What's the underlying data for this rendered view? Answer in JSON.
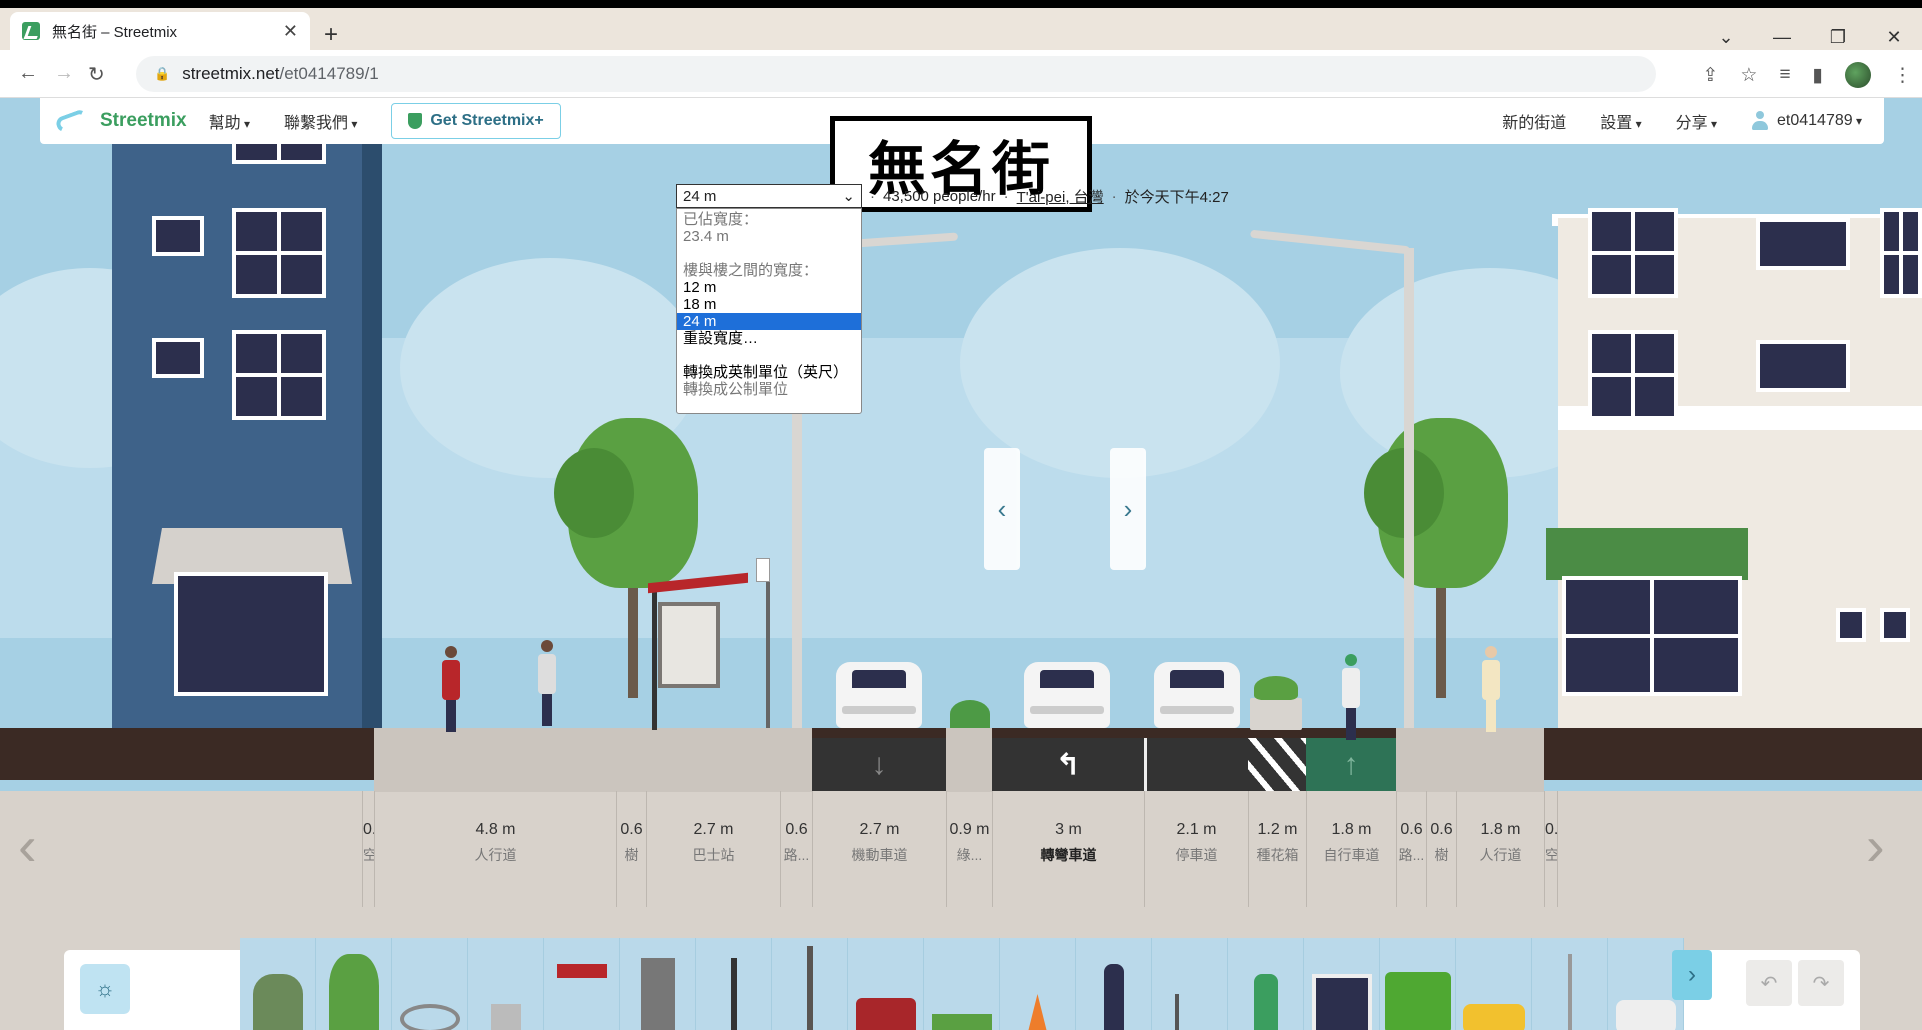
{
  "browser": {
    "tab_title": "無名街 – Streetmix",
    "url_host": "streetmix.net",
    "url_path": "/et0414789/1"
  },
  "nav": {
    "logo": "Streetmix",
    "help": "幫助",
    "contact": "聯繫我們",
    "plus": "Get Streetmix+",
    "new_street": "新的街道",
    "settings": "設置",
    "share": "分享",
    "user": "et0414789"
  },
  "street": {
    "name": "無名街",
    "width_value": "24 m",
    "people": "43,500 people/hr",
    "location": "T'ai-pei, 台灣",
    "time": "於今天下午4:27"
  },
  "width_menu": {
    "occupied_label": "已佔寬度：",
    "occupied_value": "23.4 m",
    "between_label": "樓與樓之間的寬度：",
    "opt_12": "12 m",
    "opt_18": "18 m",
    "opt_24": "24 m",
    "custom": "重設寬度…",
    "imperial": "轉換成英制單位（英尺）",
    "metric": "轉換成公制單位"
  },
  "segments": [
    {
      "w": "0.",
      "n": "空"
    },
    {
      "w": "4.8 m",
      "n": "人行道"
    },
    {
      "w": "0.6",
      "n": "樹"
    },
    {
      "w": "2.7 m",
      "n": "巴士站"
    },
    {
      "w": "0.6",
      "n": "路..."
    },
    {
      "w": "2.7 m",
      "n": "機動車道"
    },
    {
      "w": "0.9 m",
      "n": "綠..."
    },
    {
      "w": "3 m",
      "n": "轉彎車道"
    },
    {
      "w": "2.1 m",
      "n": "停車道"
    },
    {
      "w": "1.2 m",
      "n": "種花箱"
    },
    {
      "w": "1.8 m",
      "n": "自行車道"
    },
    {
      "w": "0.6",
      "n": "路..."
    },
    {
      "w": "0.6",
      "n": "樹"
    },
    {
      "w": "1.8 m",
      "n": "人行道"
    },
    {
      "w": "0.",
      "n": "空"
    }
  ],
  "icons": {
    "sun": "sun-icon",
    "undo": "undo-icon",
    "redo": "redo-icon"
  },
  "colors": {
    "brand_green": "#3b9e5f",
    "accent_blue": "#7bcfe6",
    "selected_blue": "#1e6fd9",
    "lane_dark": "#333333",
    "bike_lane": "#2e7356"
  }
}
